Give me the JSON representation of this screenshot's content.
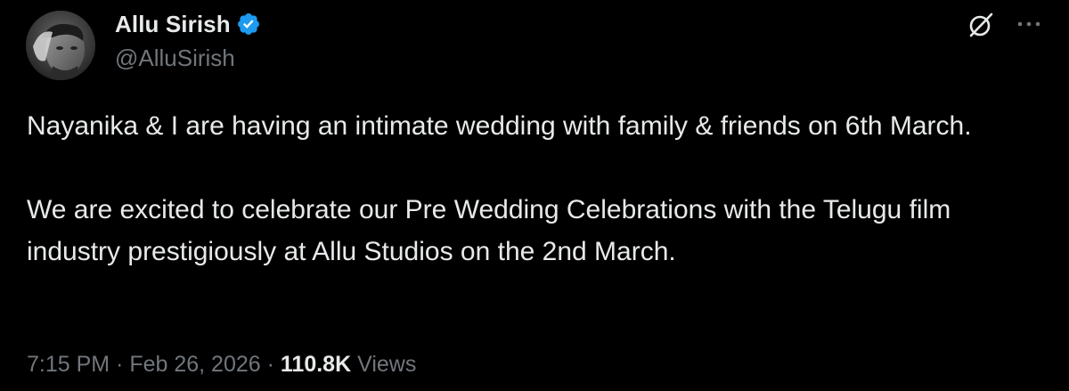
{
  "author": {
    "display_name": "Allu Sirish",
    "handle": "@AlluSirish",
    "verified": true
  },
  "tweet": {
    "paragraph_1": "Nayanika & I are having an intimate wedding with family & friends on 6th March.",
    "paragraph_2": "We are excited to celebrate our Pre Wedding Celebrations with the Telugu film industry prestigiously at Allu Studios on the 2nd March."
  },
  "meta": {
    "time": "7:15 PM",
    "separator": " · ",
    "date": "Feb 26, 2026",
    "views_count": "110.8K",
    "views_label": "Views"
  },
  "icons": {
    "verified": "verified-badge-icon",
    "grok": "grok-icon",
    "more": "more-dots-icon"
  },
  "colors": {
    "background": "#000000",
    "primary_text": "#e7e9ea",
    "secondary_text": "#71767b",
    "verified_blue": "#1d9bf0"
  }
}
